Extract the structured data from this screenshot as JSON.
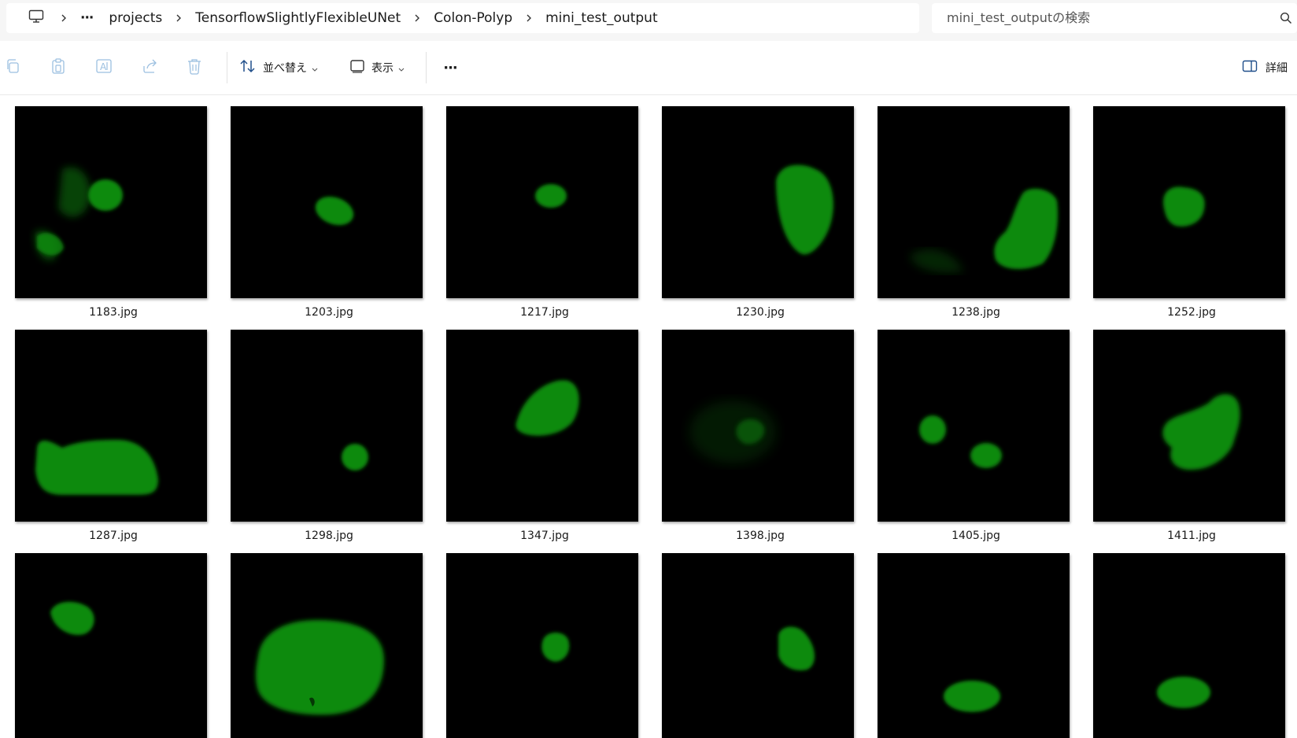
{
  "addressbar": {
    "crumbs": [
      "projects",
      "TensorflowSlightlyFlexibleUNet",
      "Colon-Polyp",
      "mini_test_output"
    ],
    "overflow": "···",
    "search_placeholder": "mini_test_outputの検索"
  },
  "toolbar": {
    "sort_label": "並べ替え",
    "view_label": "表示",
    "more_label": "···",
    "details_label": "詳細"
  },
  "files": [
    {
      "name": "1183.jpg"
    },
    {
      "name": "1203.jpg"
    },
    {
      "name": "1217.jpg"
    },
    {
      "name": "1230.jpg"
    },
    {
      "name": "1238.jpg"
    },
    {
      "name": "1252.jpg"
    },
    {
      "name": "1287.jpg"
    },
    {
      "name": "1298.jpg"
    },
    {
      "name": "1347.jpg"
    },
    {
      "name": "1398.jpg"
    },
    {
      "name": "1405.jpg"
    },
    {
      "name": "1411.jpg"
    },
    {
      "name": ""
    },
    {
      "name": ""
    },
    {
      "name": ""
    },
    {
      "name": ""
    },
    {
      "name": ""
    },
    {
      "name": ""
    }
  ],
  "colors": {
    "mask_green": "#0f8a0f",
    "mask_bg": "#000000"
  }
}
